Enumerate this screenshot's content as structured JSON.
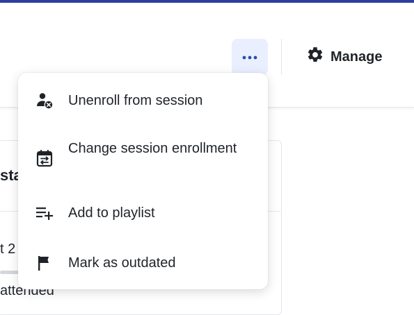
{
  "header": {
    "more_icon": "ellipsis-icon",
    "manage_label": "Manage",
    "manage_icon": "gear-icon"
  },
  "card": {
    "title_fragment": "sta",
    "row_text": "t 2",
    "status_text": "attended"
  },
  "menu": {
    "items": [
      {
        "label": "Unenroll from session",
        "icon": "user-remove-icon"
      },
      {
        "label": "Change session enrollment",
        "icon": "calendar-swap-icon"
      },
      {
        "label": "Add to playlist",
        "icon": "playlist-add-icon"
      },
      {
        "label": "Mark as outdated",
        "icon": "flag-icon"
      }
    ]
  },
  "colors": {
    "accent_bar": "#2d3e9e",
    "more_button_bg": "#e9efff",
    "more_dots": "#2d4ea8"
  }
}
